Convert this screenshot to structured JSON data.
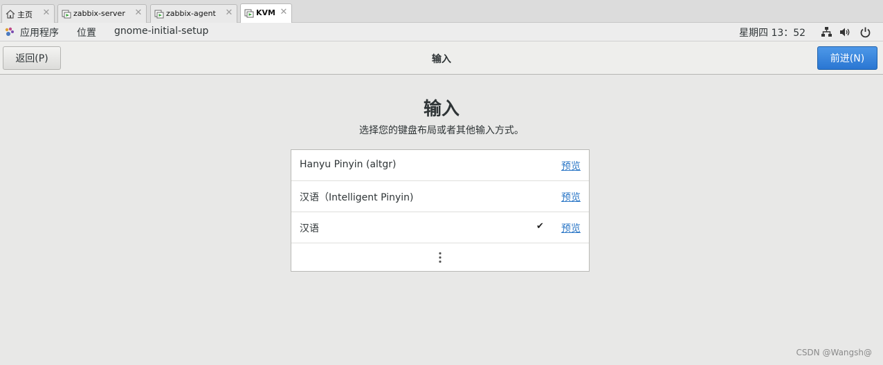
{
  "browser_tabs": [
    {
      "label": "主页",
      "icon": "home-icon",
      "active": false
    },
    {
      "label": "zabbix-server",
      "icon": "vm-icon",
      "active": false
    },
    {
      "label": "zabbix-agent",
      "icon": "vm-icon",
      "active": false
    },
    {
      "label": "KVM",
      "icon": "vm-icon",
      "active": true
    }
  ],
  "topbar": {
    "applications": "应用程序",
    "places": "位置",
    "app_name": "gnome-initial-setup",
    "clock": "星期四 13：52",
    "icons": [
      "network-icon",
      "volume-icon",
      "power-icon"
    ]
  },
  "header": {
    "back_label": "返回(P)",
    "title": "输入",
    "next_label": "前进(N)"
  },
  "page": {
    "title": "输入",
    "subtitle": "选择您的键盘布局或者其他输入方式。"
  },
  "input_sources": [
    {
      "name": "Hanyu Pinyin (altgr)",
      "preview": "预览",
      "selected": false
    },
    {
      "name": "汉语（Intelligent Pinyin)",
      "preview": "预览",
      "selected": false
    },
    {
      "name": "汉语",
      "preview": "预览",
      "selected": true
    }
  ],
  "more_icon": "vertical-ellipsis-icon",
  "check_glyph": "✔",
  "watermark": "CSDN @Wangsh@",
  "colors": {
    "accent": "#2a76d2",
    "link": "#2a76c6",
    "background": "#e8e8e7"
  }
}
